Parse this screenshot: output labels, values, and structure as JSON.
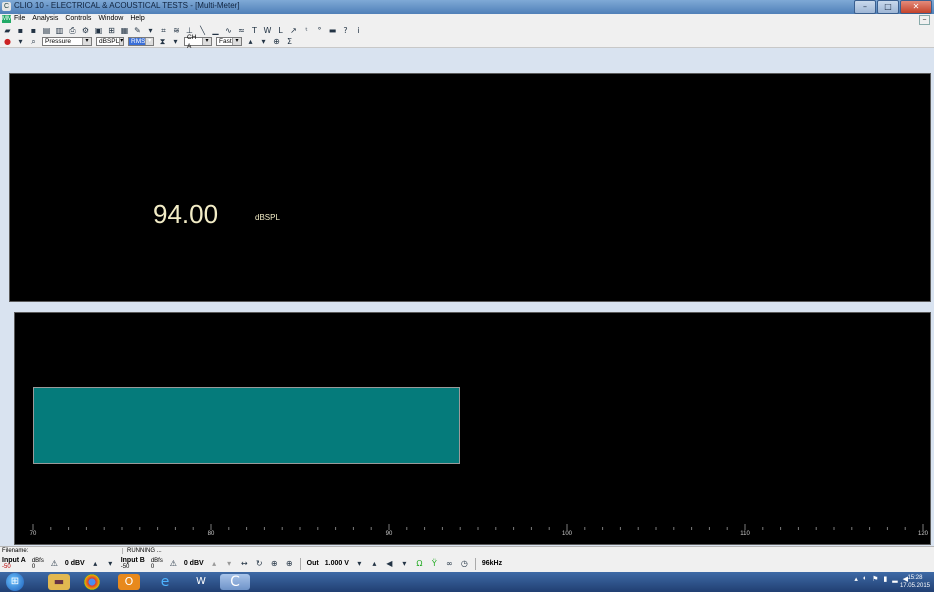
{
  "window": {
    "title": "CLIO 10 - ELECTRICAL & ACOUSTICAL TESTS - [Multi-Meter]",
    "buttons": {
      "minimize": "–",
      "maximize": "□",
      "close": "✕"
    }
  },
  "menu": {
    "app_icon": "MM",
    "items": [
      "File",
      "Analysis",
      "Controls",
      "Window",
      "Help"
    ],
    "mdi_restore": "–"
  },
  "toolbar": {
    "measurement": "Pressure",
    "unit": "dBSPL",
    "detector": "RMS",
    "channel": "CH A",
    "speed": "Fast"
  },
  "meter": {
    "value": "94.00",
    "unit": "dBSPL",
    "level_value": 94.0,
    "scale_min": 70,
    "scale_max": 120,
    "scale_labels": [
      "70",
      "80",
      "90",
      "100",
      "110",
      "120"
    ],
    "bar_color": "#057b7b"
  },
  "status": {
    "filename_label": "Filename:",
    "state": "RUNNING ..."
  },
  "controls": {
    "input_a": "Input A",
    "input_a_scale": "-50",
    "input_b": "Input B",
    "input_b_scale": "-50",
    "dbfs_label": "dBfs",
    "dbfs_zero": "0",
    "input_a_level": "0 dBV",
    "input_b_level": "0 dBV",
    "out_label": "Out",
    "out_level": "1.000 V",
    "sample_rate": "96kHz"
  },
  "taskbar": {
    "time": "15:28",
    "date": "17.05.2015",
    "apps": [
      "explorer",
      "chrome",
      "outlook",
      "internet-explorer",
      "media",
      "clio"
    ]
  }
}
